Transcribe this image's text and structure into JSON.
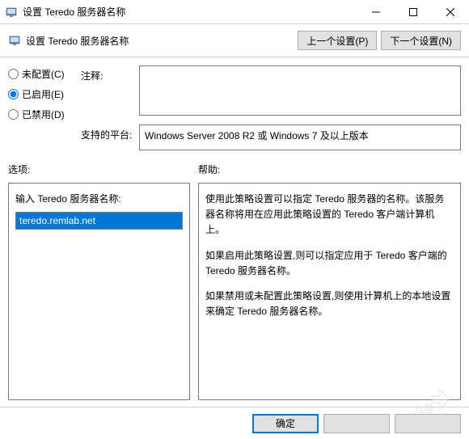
{
  "titlebar": {
    "title": "设置 Teredo 服务器名称"
  },
  "header": {
    "title": "设置 Teredo 服务器名称",
    "prev_btn": "上一个设置(P)",
    "next_btn": "下一个设置(N)"
  },
  "radios": {
    "not_configured": "未配置(C)",
    "enabled": "已启用(E)",
    "disabled": "已禁用(D)",
    "selected": "enabled"
  },
  "labels": {
    "comment": "注释:",
    "platform": "支持的平台:",
    "options": "选项:",
    "help": "帮助:"
  },
  "platform_text": "Windows Server 2008 R2 或 Windows 7 及以上版本",
  "options": {
    "input_label": "输入 Teredo 服务器名称:",
    "input_value": "teredo.remlab.net"
  },
  "help": {
    "p1": "使用此策略设置可以指定 Teredo 服务器的名称。该服务器名称将用在应用此策略设置的 Teredo 客户端计算机上。",
    "p2": "如果启用此策略设置,则可以指定应用于 Teredo 客户端的 Teredo 服务器名称。",
    "p3": "如果禁用或未配置此策略设置,则使用计算机上的本地设置来确定 Teredo 服务器名称。"
  },
  "footer": {
    "ok": "确定",
    "cancel": "",
    "apply": ""
  },
  "watermark": "九游"
}
